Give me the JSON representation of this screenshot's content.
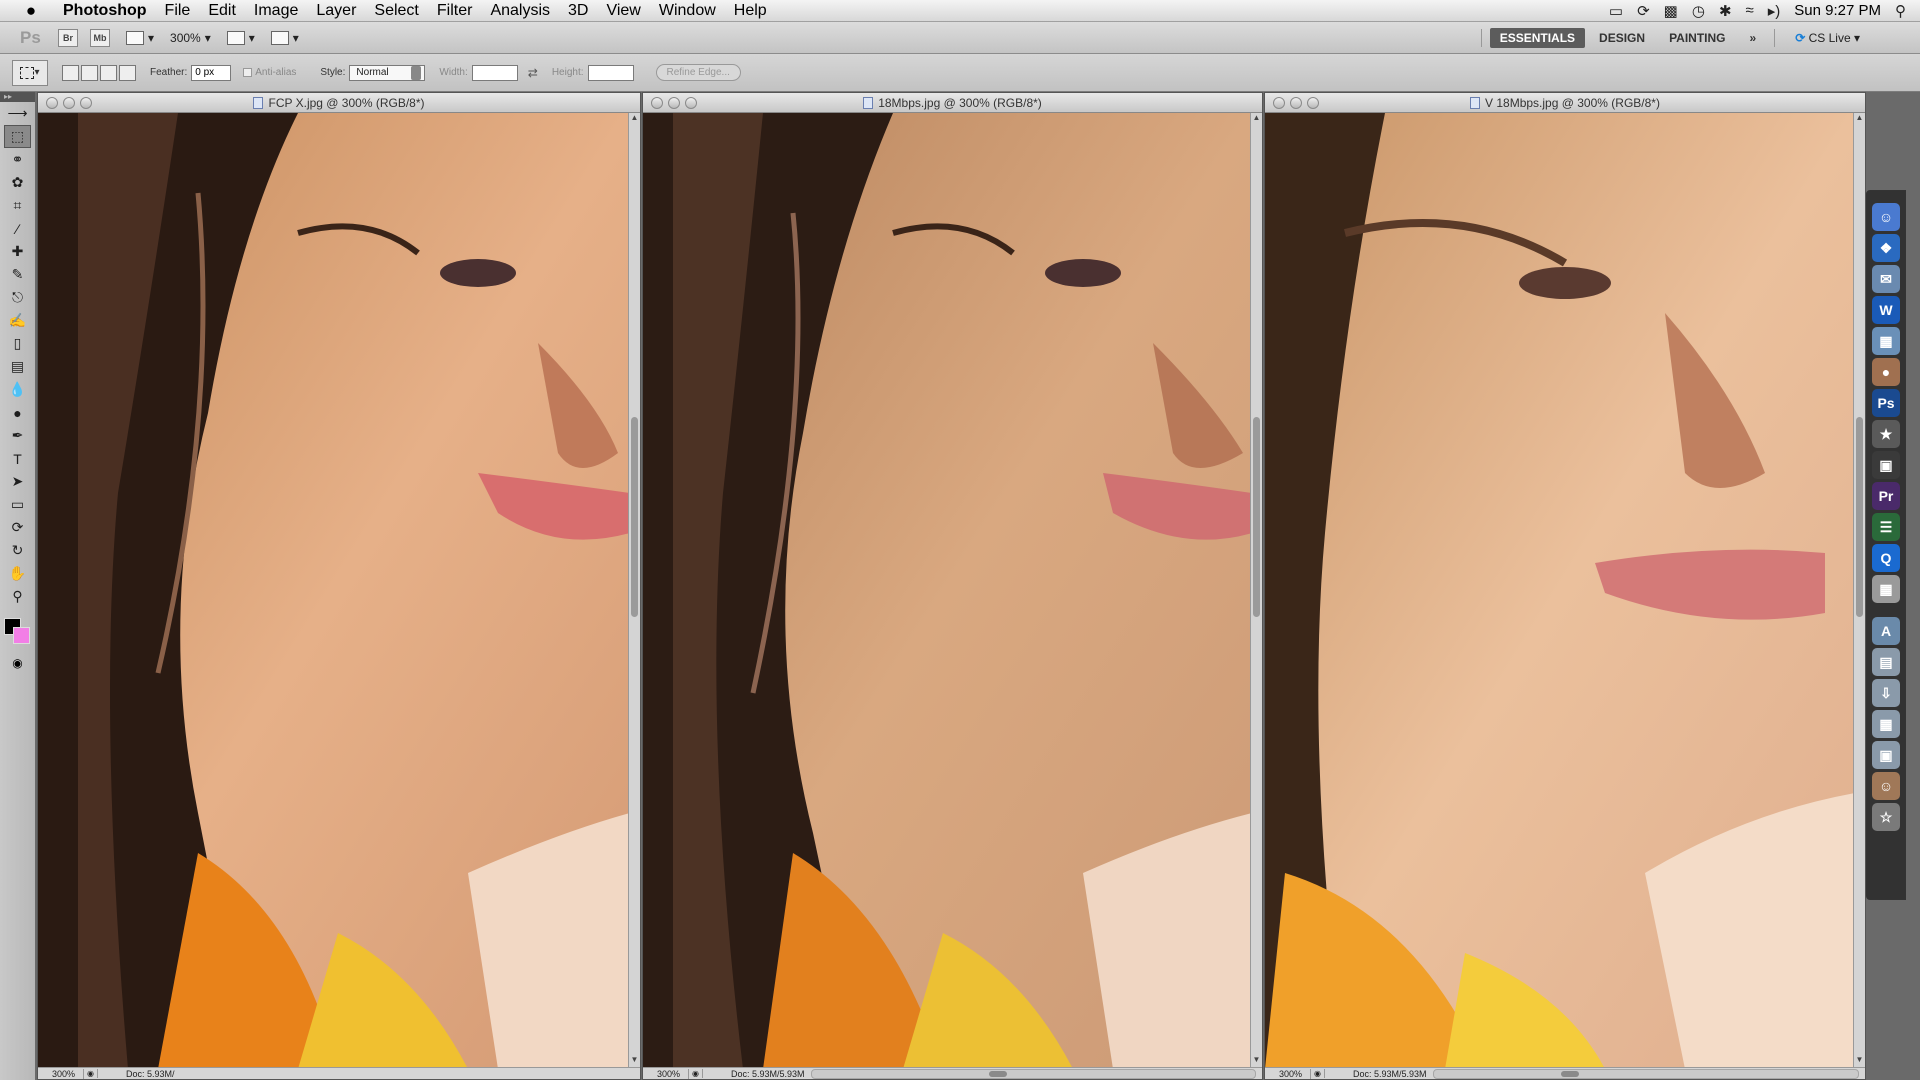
{
  "menubar": {
    "apple": "",
    "items": [
      "Photoshop",
      "File",
      "Edit",
      "Image",
      "Layer",
      "Select",
      "Filter",
      "Analysis",
      "3D",
      "View",
      "Window",
      "Help"
    ],
    "clock": "Sun 9:27 PM"
  },
  "appbar": {
    "ps_label": "Ps",
    "br_label": "Br",
    "mb_label": "Mb",
    "zoom": "300%",
    "workspaces": [
      "ESSENTIALS",
      "DESIGN",
      "PAINTING"
    ],
    "active_workspace": "ESSENTIALS",
    "more": "»",
    "cs_live": "CS Live"
  },
  "options": {
    "feather_label": "Feather:",
    "feather_value": "0 px",
    "antialias_label": "Anti-alias",
    "style_label": "Style:",
    "style_value": "Normal",
    "width_label": "Width:",
    "width_value": "",
    "height_label": "Height:",
    "height_value": "",
    "refine_edge": "Refine Edge..."
  },
  "documents": [
    {
      "title": "FCP X.jpg @ 300% (RGB/8*)",
      "zoom": "300%",
      "doc_info": "Doc: 5.93M/",
      "scroll_fraction": 0.4
    },
    {
      "title": "18Mbps.jpg @ 300% (RGB/8*)",
      "zoom": "300%",
      "doc_info": "Doc: 5.93M/5.93M",
      "scroll_fraction": 0.4
    },
    {
      "title": "V 18Mbps.jpg @ 300% (RGB/8*)",
      "zoom": "300%",
      "doc_info": "Doc: 5.93M/5.93M",
      "scroll_fraction": 0.4
    }
  ],
  "colors": {
    "foreground": "#000000",
    "background": "#f27ee6",
    "workspace_active": "#5c5c5c"
  },
  "tools": [
    "move-tool",
    "rectangular-marquee-tool",
    "lasso-tool",
    "quick-selection-tool",
    "crop-tool",
    "eyedropper-tool",
    "spot-healing-tool",
    "brush-tool",
    "clone-stamp-tool",
    "history-brush-tool",
    "eraser-tool",
    "gradient-tool",
    "blur-tool",
    "dodge-tool",
    "pen-tool",
    "type-tool",
    "path-selection-tool",
    "rectangle-tool",
    "3d-rotate-tool",
    "3d-orbit-tool",
    "hand-tool",
    "zoom-tool"
  ],
  "dock_icons": [
    "finder-icon",
    "safari-icon",
    "mail-icon",
    "word-icon",
    "preview-icon",
    "iphoto-icon",
    "photoshop-icon",
    "imovie-icon",
    "fcp-icon",
    "premiere-icon",
    "stack-icon",
    "quicktime-icon",
    "calculator-icon",
    "applications-icon",
    "documents-icon",
    "downloads-icon",
    "pictures-icon",
    "movies-icon",
    "photo-stack-icon",
    "trash-icon"
  ],
  "dock_labels": {
    "photoshop": "Ps",
    "premiere": "Pr",
    "word": "W"
  }
}
